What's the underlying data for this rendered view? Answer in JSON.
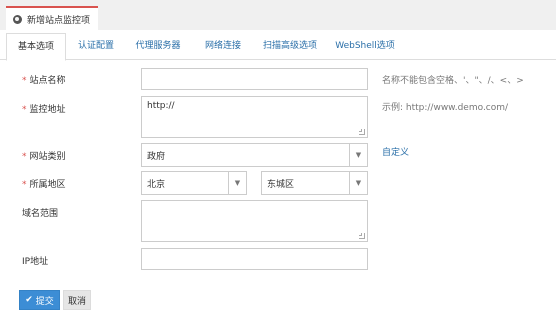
{
  "page": {
    "title": "新增站点监控项",
    "icon": "globe-icon"
  },
  "tabs": [
    {
      "label": "基本选项",
      "active": true
    },
    {
      "label": "认证配置",
      "active": false
    },
    {
      "label": "代理服务器",
      "active": false
    },
    {
      "label": "网络连接",
      "active": false
    },
    {
      "label": "扫描高级选项",
      "active": false
    },
    {
      "label": "WebShell选项",
      "active": false
    }
  ],
  "form": {
    "required_mark": "*",
    "site_name": {
      "label": "站点名称",
      "value": "",
      "hint": "名称不能包含空格、'、\"、/、<、>"
    },
    "monitor_url": {
      "label": "监控地址",
      "value": "http://",
      "hint": "示例: http://www.demo.com/"
    },
    "site_type": {
      "label": "网站类别",
      "selected": "政府",
      "custom_link": "自定义"
    },
    "region": {
      "label": "所属地区",
      "province": "北京",
      "district": "东城区"
    },
    "domain_scope": {
      "label": "域名范围",
      "value": ""
    },
    "ip_address": {
      "label": "IP地址",
      "value": ""
    }
  },
  "actions": {
    "submit": "提交",
    "cancel": "取消"
  },
  "colors": {
    "accent": "#d9534f",
    "primary": "#3c8dd5",
    "link": "#2a6fa8"
  }
}
